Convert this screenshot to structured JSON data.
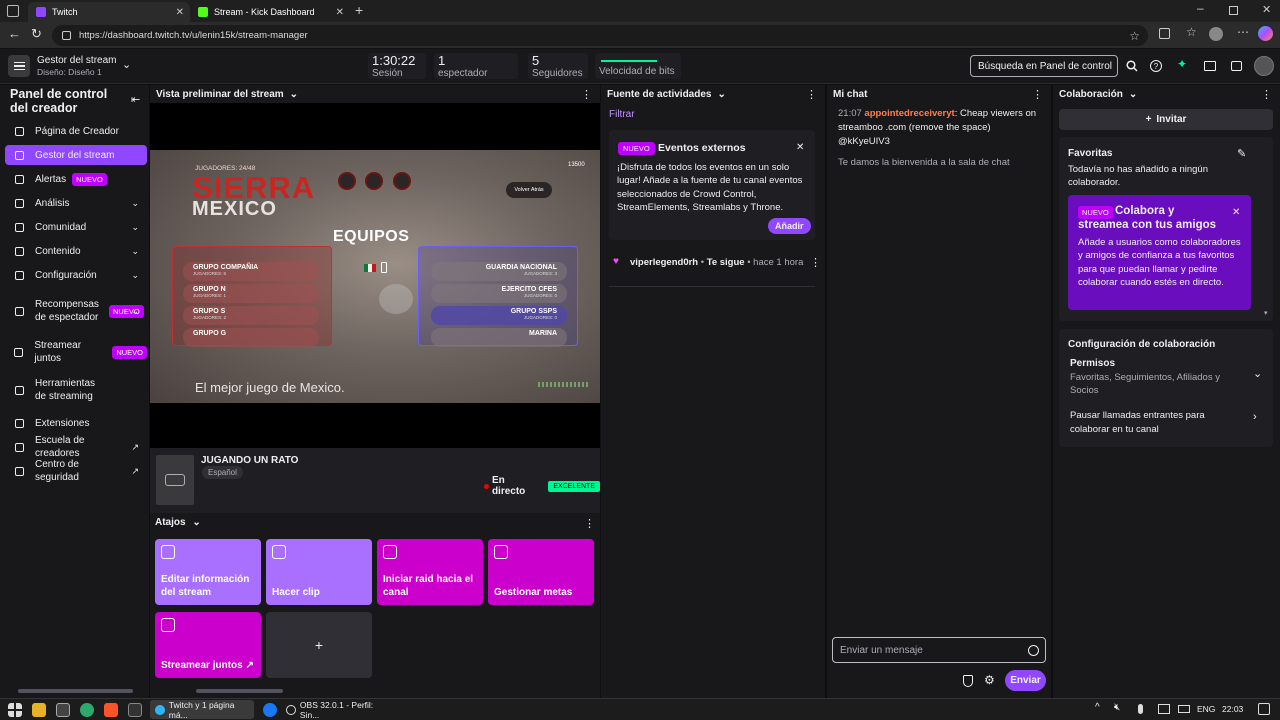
{
  "browser": {
    "tabs": [
      {
        "title": "Twitch",
        "active": true
      },
      {
        "title": "Stream - Kick Dashboard",
        "active": false
      }
    ],
    "url": "https://dashboard.twitch.tv/u/lenin15k/stream-manager"
  },
  "topbar": {
    "manager_title": "Gestor del stream",
    "layout_label": "Diseño: Diseño 1",
    "session_value": "1:30:22",
    "session_label": "Sesión",
    "viewers_value": "1",
    "viewers_label": "espectador",
    "followers_value": "5",
    "followers_label": "Seguidores",
    "bitrate_label": "Velocidad de bits",
    "search_placeholder": "Búsqueda en Panel de control"
  },
  "sidebar": {
    "title": "Panel de control del creador",
    "items": [
      {
        "label": "Página de Creador",
        "icon": "creator-page-icon"
      },
      {
        "label": "Gestor del stream",
        "icon": "broadcast-icon",
        "selected": true
      },
      {
        "label": "Alertas",
        "icon": "alert-icon",
        "badge": "NUEVO"
      },
      {
        "label": "Análisis",
        "icon": "analytics-icon",
        "expand": true
      },
      {
        "label": "Comunidad",
        "icon": "community-icon",
        "expand": true
      },
      {
        "label": "Contenido",
        "icon": "content-icon",
        "expand": true
      },
      {
        "label": "Configuración",
        "icon": "settings-icon",
        "expand": true
      },
      {
        "label": "Recompensas de espectador",
        "icon": "rewards-icon",
        "badge": "NUEVO",
        "expand": true
      },
      {
        "label": "Streamear juntos",
        "icon": "stream-together-icon",
        "badge": "NUEVO"
      },
      {
        "label": "Herramientas de streaming",
        "icon": "tools-icon"
      },
      {
        "label": "Extensiones",
        "icon": "extensions-icon"
      },
      {
        "label": "Escuela de creadores",
        "icon": "school-icon",
        "external": true
      },
      {
        "label": "Centro de seguridad",
        "icon": "shield-icon",
        "external": true
      }
    ]
  },
  "preview": {
    "header": "Vista preliminar del stream",
    "game_team_header": "JUGADORES: 24/48",
    "game_title": "SIERRA",
    "game_subtitle": "MEXICO",
    "equipos": "EQUIPOS",
    "coins": "13500",
    "back_button": "Volver Atrás",
    "teams_left": [
      {
        "name": "GRUPO COMPAÑIA",
        "players": "JUGADORES: 6"
      },
      {
        "name": "GRUPO N",
        "players": "JUGADORES: 1"
      },
      {
        "name": "GRUPO S",
        "players": "JUGADORES: 2"
      },
      {
        "name": "GRUPO G",
        "players": ""
      }
    ],
    "teams_right": [
      {
        "name": "GUARDIA NACIONAL",
        "players": "JUGADORES: 3"
      },
      {
        "name": "EJERCITO CFES",
        "players": "JUGADORES: 0"
      },
      {
        "name": "GRUPO SSPS",
        "players": "JUGADORES: 0"
      },
      {
        "name": "MARINA",
        "players": ""
      }
    ],
    "tagline": "El mejor juego de Mexico.",
    "stream_title": "JUGANDO UN RATO",
    "language": "Español",
    "live_label": "En directo",
    "quality_label": "EXCELENTE"
  },
  "shortcuts": {
    "header": "Atajos",
    "items": [
      {
        "label": "Editar información del stream",
        "color": "#a970ff",
        "icon": "pencil-icon"
      },
      {
        "label": "Hacer clip",
        "color": "#a970ff",
        "icon": "clip-icon"
      },
      {
        "label": "Iniciar raid hacia el canal",
        "color": "#cc00cc",
        "icon": "raid-icon"
      },
      {
        "label": "Gestionar metas",
        "color": "#cc00cc",
        "icon": "star-icon"
      },
      {
        "label": "Streamear juntos ↗",
        "color": "#cc00cc",
        "icon": "add-user-icon"
      }
    ],
    "add_label": "+"
  },
  "activity": {
    "header": "Fuente de actividades",
    "filter_label": "Filtrar",
    "card_badge": "NUEVO",
    "card_title": "Eventos externos",
    "card_body": "¡Disfruta de todos los eventos en un solo lugar! Añade a la fuente de tu canal eventos seleccionados de Crowd Control, StreamElements, Streamlabs y Throne.",
    "card_button": "Añadir",
    "event_user": "viperlegend0rh",
    "event_action": "Te sigue",
    "event_time": "hace 1 hora"
  },
  "chat": {
    "header": "Mi chat",
    "msg_time": "21:07",
    "msg_user": "appointedreceiveryt",
    "msg_text": "Cheap viewers on streamboo .com (remove the space) @kKyeUIV3",
    "welcome": "Te damos la bienvenida a la sala de chat",
    "input_placeholder": "Enviar un mensaje",
    "send_label": "Enviar"
  },
  "collab": {
    "header": "Colaboración",
    "invite_label": "Invitar",
    "favorites_title": "Favoritas",
    "favorites_empty": "Todavía no has añadido a ningún colaborador.",
    "promo_badge": "NUEVO",
    "promo_title": "Colabora y streamea con tus amigos",
    "promo_body": "Añade a usuarios como colaboradores y amigos de confianza a tus favoritos para que puedan llamar y pedirte colaborar cuando estés en directo.",
    "config_title": "Configuración de colaboración",
    "perm_title": "Permisos",
    "perm_value": "Favoritas, Seguimientos, Afiliados y Socios",
    "pause_label": "Pausar llamadas entrantes para colaborar en tu canal"
  },
  "taskbar": {
    "app1": "Twitch y 1 página má...",
    "app2": "OBS 32.0.1 - Perfil: Sin...",
    "lang": "ENG",
    "time": "22:03"
  },
  "colors": {
    "accent": "#9147ff",
    "magenta": "#bf00ff",
    "live_red": "#eb0400",
    "excellent_green": "#00f593"
  }
}
